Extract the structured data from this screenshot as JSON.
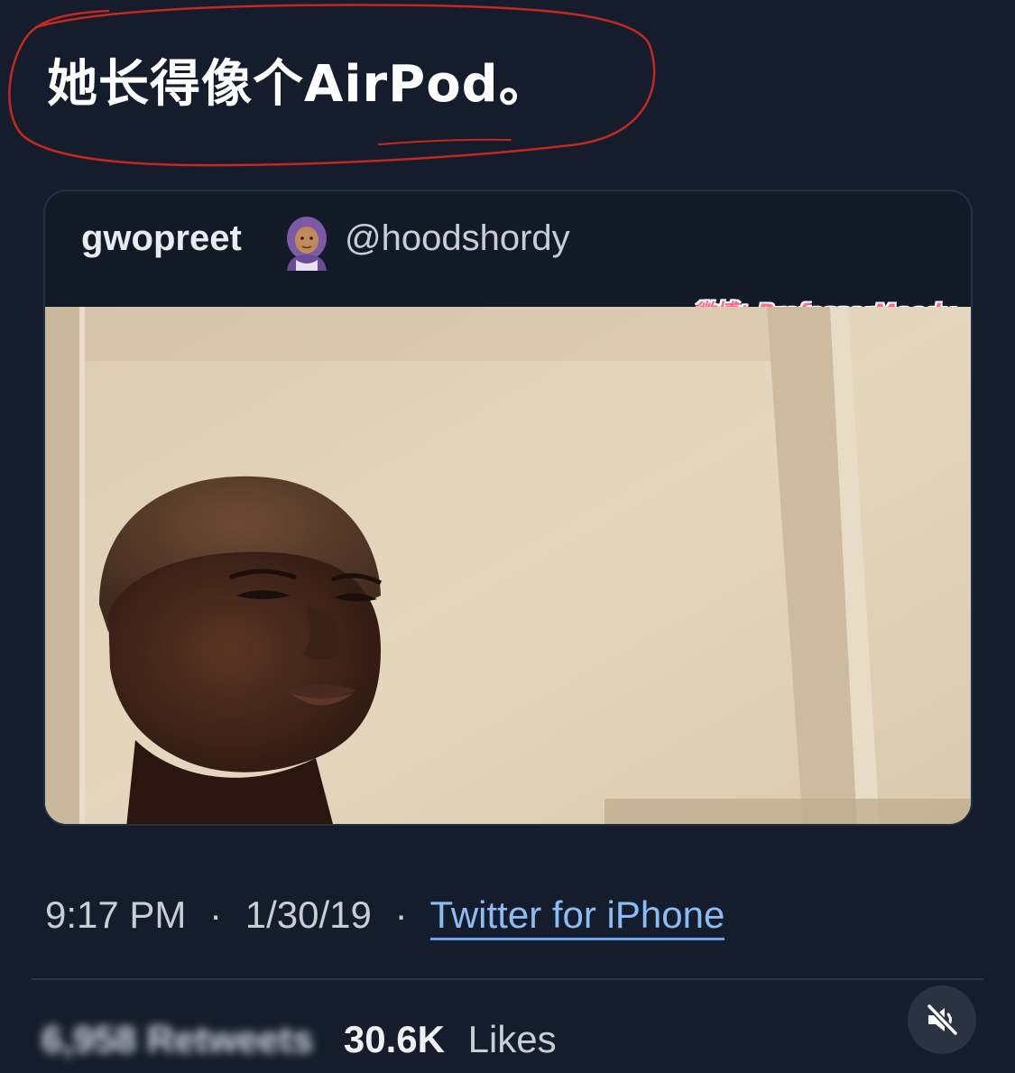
{
  "caption": {
    "text": "她长得像个AirPod。",
    "circle_color": "#c4291f"
  },
  "quoted_tweet": {
    "display_name": "gwopreet",
    "avatar_icon": "woman-with-headscarf-emoji",
    "handle": "@hoodshordy",
    "watermark": "微博：ProfessorMoody"
  },
  "meta": {
    "time": "9:17 PM",
    "date": "1/30/19",
    "separator": "·",
    "source": "Twitter for iPhone"
  },
  "stats": {
    "blurred_retweets": "6,958 Retweets",
    "likes_count": "30.6K",
    "likes_label": "Likes"
  },
  "controls": {
    "mute_icon": "speaker-muted-icon"
  },
  "colors": {
    "background": "#151c2b",
    "link": "#8cbcf5",
    "watermark": "#ff6b8a"
  }
}
